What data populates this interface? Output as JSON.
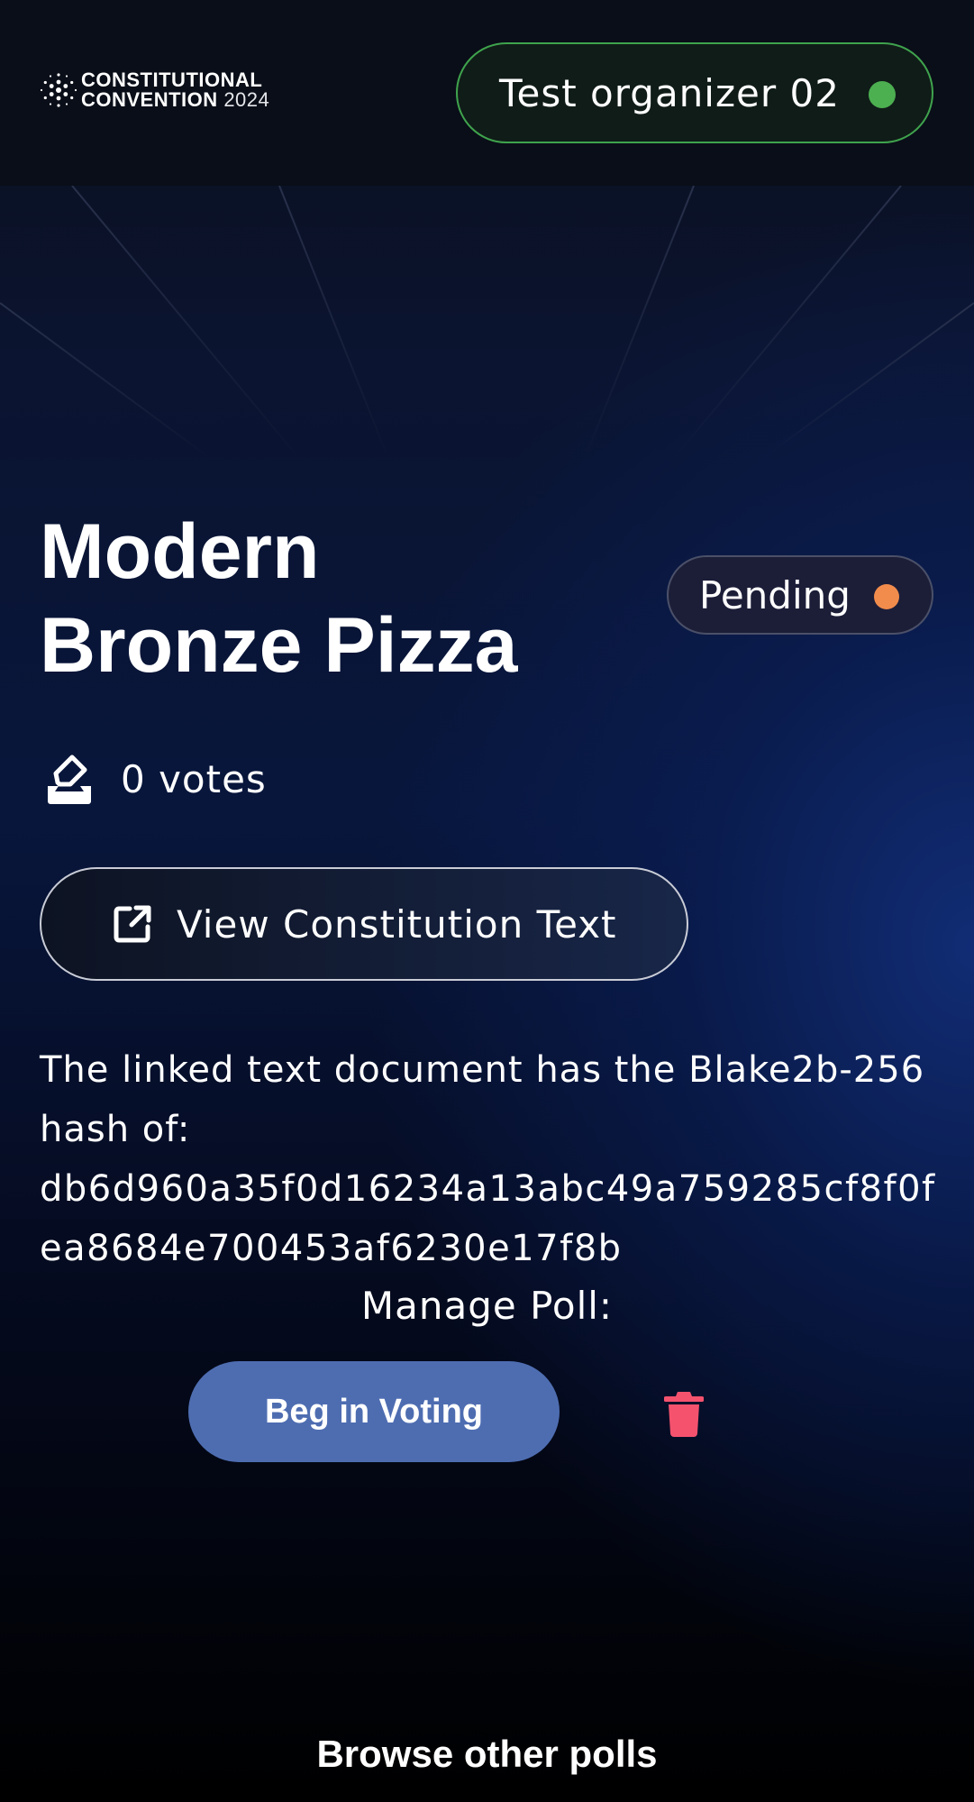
{
  "header": {
    "logo_line1": "CONSTITUTIONAL",
    "logo_line2": "CONVENTION",
    "logo_year": "2024",
    "user_name": "Test organizer 02",
    "user_status_color": "#4caf50"
  },
  "poll": {
    "title_line1": "Modern",
    "title_line2": "Bronze Pizza",
    "status": "Pending",
    "status_color": "#f28c4c",
    "votes": "0 votes",
    "view_button_label": "View Constitution Text",
    "hash_intro": "The linked text document has the Blake2b-256 hash of:",
    "hash_value": "db6d960a35f0d16234a13abc49a759285cf8f0fea8684e700453af6230e17f8b"
  },
  "manage": {
    "label": "Manage Poll:",
    "begin_button": "Beg in Voting",
    "delete_icon": "trash-icon",
    "delete_color": "#f5526e"
  },
  "footer": {
    "browse_link": "Browse other polls"
  },
  "colors": {
    "accent_button": "#4e6db1",
    "header_bg": "#0a0e18"
  }
}
